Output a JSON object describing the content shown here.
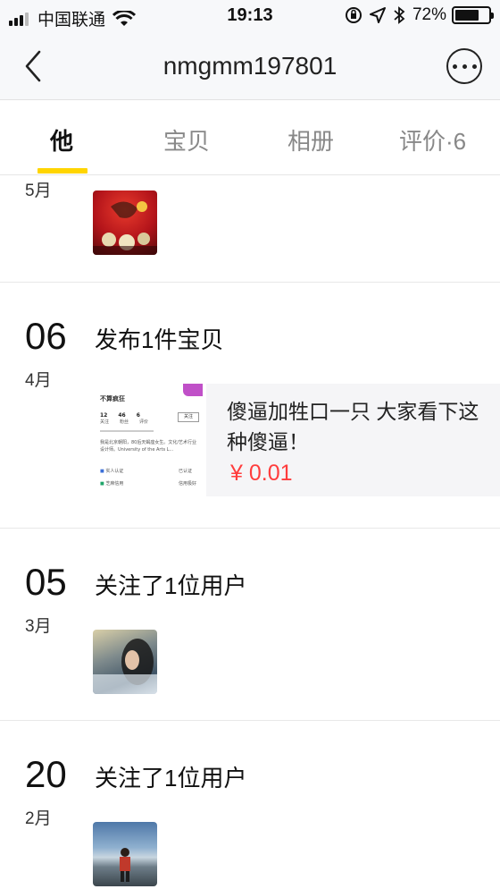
{
  "status_bar": {
    "carrier": "中国联通",
    "time": "19:13",
    "battery_percent": "72%",
    "battery_level": 0.72,
    "icons": [
      "signal-icon",
      "wifi-icon",
      "orientation-lock-icon",
      "location-icon",
      "bluetooth-icon",
      "battery-icon"
    ]
  },
  "nav": {
    "title": "nmgmm197801",
    "back_icon": "back-chevron-icon",
    "more_icon": "more-icon"
  },
  "tabs": [
    {
      "label": "他",
      "active": true
    },
    {
      "label": "宝贝",
      "active": false
    },
    {
      "label": "相册",
      "active": false
    },
    {
      "label": "评价·6",
      "active": false
    }
  ],
  "accent_color": "#ffd500",
  "price_color": "#ff3d3d",
  "feed": [
    {
      "day": "",
      "month": "5月",
      "title": "",
      "thumb": "red-artwork-thumbnail"
    },
    {
      "day": "06",
      "month": "4月",
      "title": "发布1件宝贝",
      "item": {
        "description": "傻逼加牲口一只 大家看下这种傻逼！",
        "price": "¥ 0.01",
        "preview": {
          "name": "不算疯狂",
          "stats": [
            {
              "num": "12",
              "label": "关注"
            },
            {
              "num": "46",
              "label": "粉丝"
            },
            {
              "num": "6",
              "label": "评价"
            }
          ],
          "follow": "关注",
          "bio": "我是北京朝阳，80后天蝎座女生。文化/艺术行业设计师。University of the Arts L...",
          "verify": "实人认证",
          "verify_status": "已认证",
          "credit": "芝麻信用",
          "credit_status": "信用极好"
        }
      }
    },
    {
      "day": "05",
      "month": "3月",
      "title": "关注了1位用户",
      "thumb": "user-avatar-woman"
    },
    {
      "day": "20",
      "month": "2月",
      "title": "关注了1位用户",
      "thumb": "user-avatar-beach"
    }
  ]
}
